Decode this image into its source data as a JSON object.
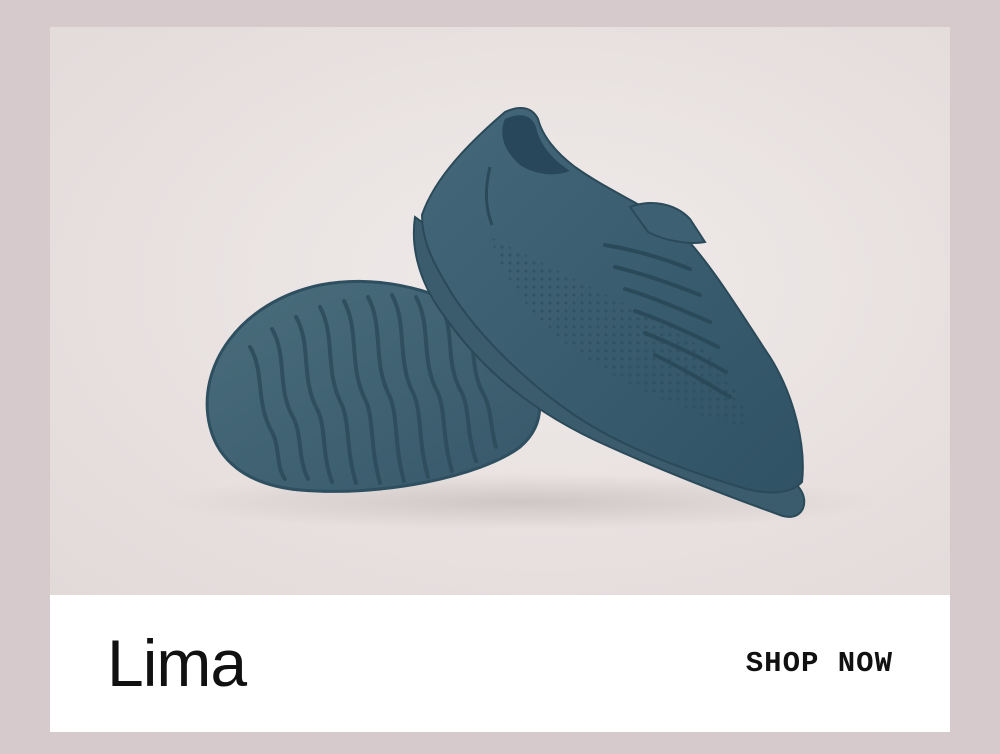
{
  "product": {
    "name": "Lima",
    "image_subject": "pair-of-teal-knit-sneakers",
    "color": "#3d5f6e"
  },
  "cta": {
    "label": "SHOP NOW"
  },
  "colors": {
    "page_background": "#d6cacc",
    "hero_background": "#ebe6e5",
    "footer_background": "#ffffff",
    "text": "#111111"
  }
}
